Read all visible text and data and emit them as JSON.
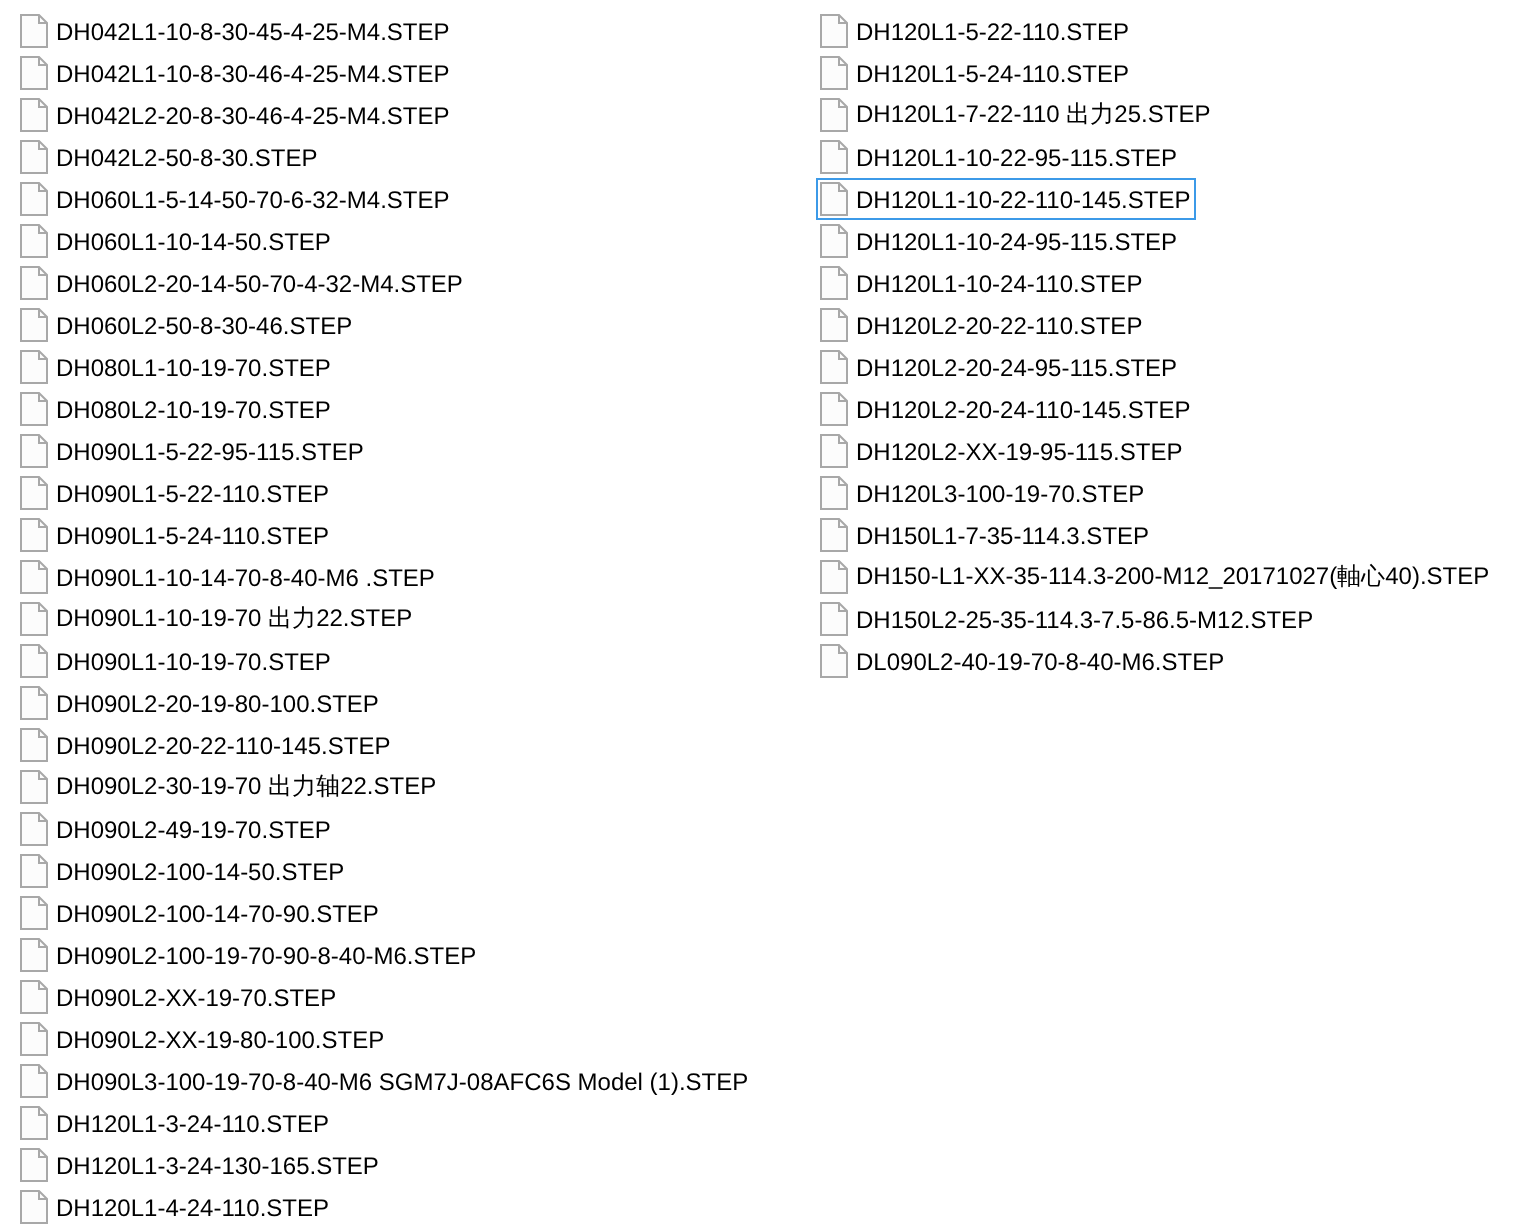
{
  "columns": [
    {
      "files": [
        {
          "name": "DH042L1-10-8-30-45-4-25-M4.STEP",
          "selected": false
        },
        {
          "name": "DH042L1-10-8-30-46-4-25-M4.STEP",
          "selected": false
        },
        {
          "name": "DH042L2-20-8-30-46-4-25-M4.STEP",
          "selected": false
        },
        {
          "name": "DH042L2-50-8-30.STEP",
          "selected": false
        },
        {
          "name": "DH060L1-5-14-50-70-6-32-M4.STEP",
          "selected": false
        },
        {
          "name": "DH060L1-10-14-50.STEP",
          "selected": false
        },
        {
          "name": "DH060L2-20-14-50-70-4-32-M4.STEP",
          "selected": false
        },
        {
          "name": "DH060L2-50-8-30-46.STEP",
          "selected": false
        },
        {
          "name": "DH080L1-10-19-70.STEP",
          "selected": false
        },
        {
          "name": "DH080L2-10-19-70.STEP",
          "selected": false
        },
        {
          "name": "DH090L1-5-22-95-115.STEP",
          "selected": false
        },
        {
          "name": "DH090L1-5-22-110.STEP",
          "selected": false
        },
        {
          "name": "DH090L1-5-24-110.STEP",
          "selected": false
        },
        {
          "name": "DH090L1-10-14-70-8-40-M6 .STEP",
          "selected": false
        },
        {
          "name": "DH090L1-10-19-70 出力22.STEP",
          "selected": false
        },
        {
          "name": "DH090L1-10-19-70.STEP",
          "selected": false
        },
        {
          "name": "DH090L2-20-19-80-100.STEP",
          "selected": false
        },
        {
          "name": "DH090L2-20-22-110-145.STEP",
          "selected": false
        },
        {
          "name": "DH090L2-30-19-70 出力轴22.STEP",
          "selected": false
        },
        {
          "name": "DH090L2-49-19-70.STEP",
          "selected": false
        },
        {
          "name": "DH090L2-100-14-50.STEP",
          "selected": false
        },
        {
          "name": "DH090L2-100-14-70-90.STEP",
          "selected": false
        },
        {
          "name": "DH090L2-100-19-70-90-8-40-M6.STEP",
          "selected": false
        },
        {
          "name": "DH090L2-XX-19-70.STEP",
          "selected": false
        },
        {
          "name": "DH090L2-XX-19-80-100.STEP",
          "selected": false
        },
        {
          "name": "DH090L3-100-19-70-8-40-M6 SGM7J-08AFC6S Model (1).STEP",
          "selected": false
        },
        {
          "name": "DH120L1-3-24-110.STEP",
          "selected": false
        },
        {
          "name": "DH120L1-3-24-130-165.STEP",
          "selected": false
        },
        {
          "name": "DH120L1-4-24-110.STEP",
          "selected": false
        }
      ]
    },
    {
      "files": [
        {
          "name": "DH120L1-5-22-110.STEP",
          "selected": false
        },
        {
          "name": "DH120L1-5-24-110.STEP",
          "selected": false
        },
        {
          "name": "DH120L1-7-22-110 出力25.STEP",
          "selected": false
        },
        {
          "name": "DH120L1-10-22-95-115.STEP",
          "selected": false
        },
        {
          "name": "DH120L1-10-22-110-145.STEP",
          "selected": true
        },
        {
          "name": "DH120L1-10-24-95-115.STEP",
          "selected": false
        },
        {
          "name": "DH120L1-10-24-110.STEP",
          "selected": false
        },
        {
          "name": "DH120L2-20-22-110.STEP",
          "selected": false
        },
        {
          "name": "DH120L2-20-24-95-115.STEP",
          "selected": false
        },
        {
          "name": "DH120L2-20-24-110-145.STEP",
          "selected": false
        },
        {
          "name": "DH120L2-XX-19-95-115.STEP",
          "selected": false
        },
        {
          "name": "DH120L3-100-19-70.STEP",
          "selected": false
        },
        {
          "name": "DH150L1-7-35-114.3.STEP",
          "selected": false
        },
        {
          "name": "DH150-L1-XX-35-114.3-200-M12_20171027(軸心40).STEP",
          "selected": false
        },
        {
          "name": "DH150L2-25-35-114.3-7.5-86.5-M12.STEP",
          "selected": false
        },
        {
          "name": "DL090L2-40-19-70-8-40-M6.STEP",
          "selected": false
        }
      ]
    }
  ]
}
